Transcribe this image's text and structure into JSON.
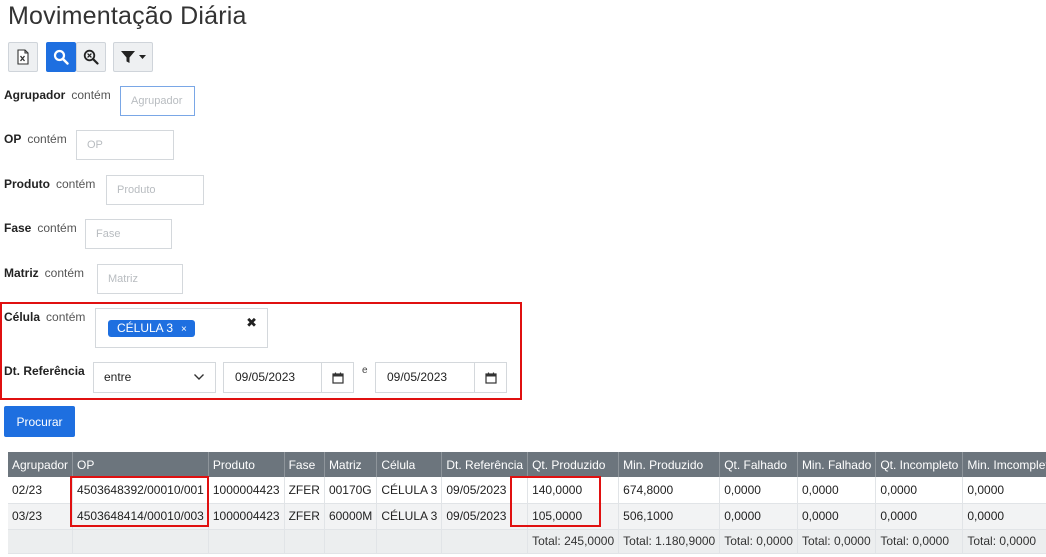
{
  "page": {
    "title": "Movimentação Diária"
  },
  "toolbar": {
    "excel_icon": "excel-export-icon",
    "search_icon": "search-icon",
    "clear_search_icon": "zoom-clear-icon",
    "filter_icon": "filter-dropdown-icon"
  },
  "filters": {
    "op_word": "contém",
    "agrupador": {
      "label": "Agrupador",
      "placeholder": "Agrupador"
    },
    "op": {
      "label": "OP",
      "placeholder": "OP"
    },
    "produto": {
      "label": "Produto",
      "placeholder": "Produto"
    },
    "fase": {
      "label": "Fase",
      "placeholder": "Fase"
    },
    "matriz": {
      "label": "Matriz",
      "placeholder": "Matriz"
    },
    "celula": {
      "label": "Célula",
      "chip": "CÉLULA 3",
      "chip_x": "×",
      "clear": "✖"
    },
    "dt_ref": {
      "label": "Dt. Referência",
      "mode": "entre",
      "from": "09/05/2023",
      "sep": "e",
      "to": "09/05/2023"
    }
  },
  "buttons": {
    "procurar": "Procurar"
  },
  "table": {
    "columns": [
      "Agrupador",
      "OP",
      "Produto",
      "Fase",
      "Matriz",
      "Célula",
      "Dt. Referência",
      "Qt. Produzido",
      "Min. Produzido",
      "Qt. Falhado",
      "Min. Falhado",
      "Qt. Incompleto",
      "Min. Imcompleto"
    ],
    "rows": [
      [
        "02/23",
        "4503648392/00010/001",
        "1000004423",
        "ZFER",
        "00170G",
        "CÉLULA 3",
        "09/05/2023",
        "140,0000",
        "674,8000",
        "0,0000",
        "0,0000",
        "0,0000",
        "0,0000"
      ],
      [
        "03/23",
        "4503648414/00010/003",
        "1000004423",
        "ZFER",
        "60000M",
        "CÉLULA 3",
        "09/05/2023",
        "105,0000",
        "506,1000",
        "0,0000",
        "0,0000",
        "0,0000",
        "0,0000"
      ]
    ],
    "totals": [
      "",
      "",
      "",
      "",
      "",
      "",
      "",
      "Total: 245,0000",
      "Total: 1.180,9000",
      "Total: 0,0000",
      "Total: 0,0000",
      "Total: 0,0000",
      "Total: 0,0000"
    ]
  },
  "colors": {
    "primary": "#1e6fe0",
    "header": "#6c757d",
    "highlight": "#e01010"
  }
}
